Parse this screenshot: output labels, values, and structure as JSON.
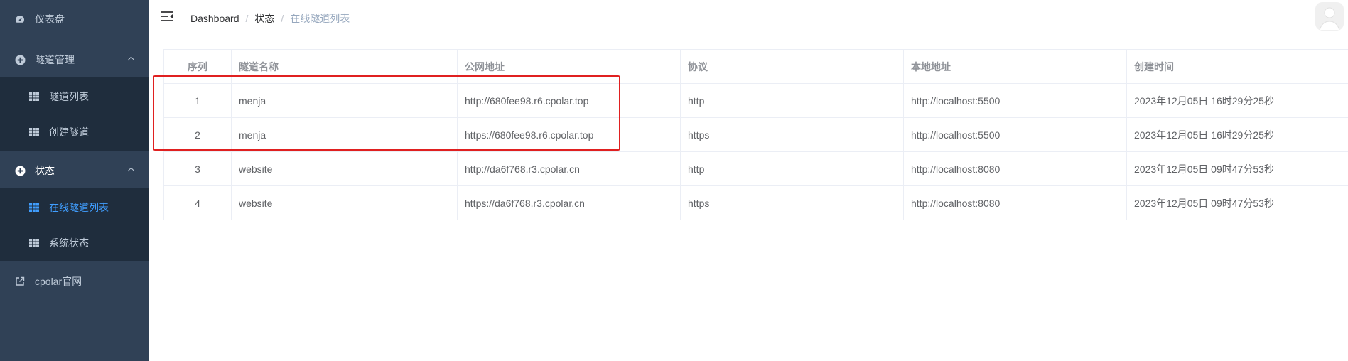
{
  "sidebar": {
    "dashboard": {
      "label": "仪表盘",
      "icon": "dashboard-icon"
    },
    "tunnel_mgmt": {
      "label": "隧道管理",
      "icon": "plus-circle-icon",
      "children": [
        {
          "label": "隧道列表",
          "icon": "grid-icon"
        },
        {
          "label": "创建隧道",
          "icon": "grid-icon"
        }
      ]
    },
    "status": {
      "label": "状态",
      "icon": "plus-circle-icon",
      "children": [
        {
          "label": "在线隧道列表",
          "icon": "grid-icon",
          "active": true
        },
        {
          "label": "系统状态",
          "icon": "grid-icon"
        }
      ]
    },
    "official": {
      "label": "cpolar官网",
      "icon": "external-link-icon"
    }
  },
  "navbar": {
    "breadcrumb": [
      "Dashboard",
      "状态",
      "在线隧道列表"
    ]
  },
  "table": {
    "headers": [
      "序列",
      "隧道名称",
      "公网地址",
      "协议",
      "本地地址",
      "创建时间"
    ],
    "rows": [
      [
        "1",
        "menja",
        "http://680fee98.r6.cpolar.top",
        "http",
        "http://localhost:5500",
        "2023年12月05日 16时29分25秒"
      ],
      [
        "2",
        "menja",
        "https://680fee98.r6.cpolar.top",
        "https",
        "http://localhost:5500",
        "2023年12月05日 16时29分25秒"
      ],
      [
        "3",
        "website",
        "http://da6f768.r3.cpolar.cn",
        "http",
        "http://localhost:8080",
        "2023年12月05日 09时47分53秒"
      ],
      [
        "4",
        "website",
        "https://da6f768.r3.cpolar.cn",
        "https",
        "http://localhost:8080",
        "2023年12月05日 09时47分53秒"
      ]
    ]
  },
  "colors": {
    "sidebar_bg": "#304156",
    "submenu_bg": "#1f2d3d",
    "active": "#409eff",
    "highlight": "#e02020"
  }
}
